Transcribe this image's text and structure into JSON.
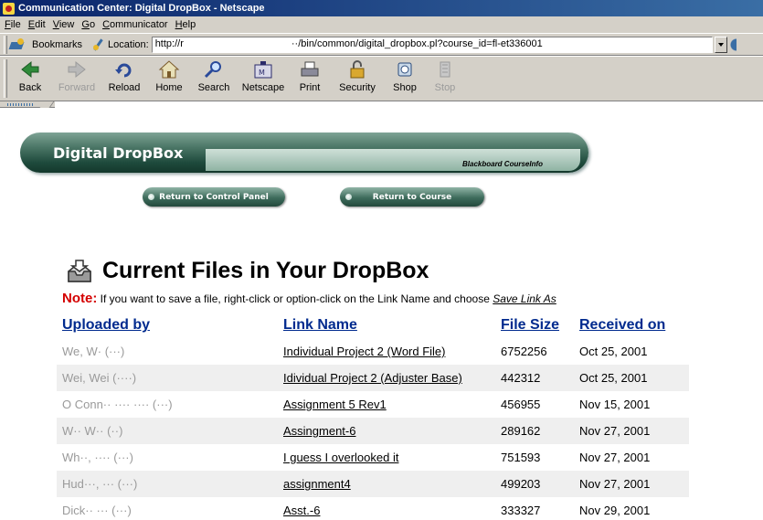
{
  "window": {
    "title": "Communication Center: Digital DropBox - Netscape"
  },
  "menu": [
    "File",
    "Edit",
    "View",
    "Go",
    "Communicator",
    "Help"
  ],
  "location_bar": {
    "bookmarks_label": "Bookmarks",
    "location_label": "Location:",
    "url_start": "http://r",
    "url_end": "··/bin/common/digital_dropbox.pl?course_id=fl-et336001"
  },
  "toolbar": [
    {
      "label": "Back",
      "icon": "back-arrow-icon",
      "enabled": true
    },
    {
      "label": "Forward",
      "icon": "forward-arrow-icon",
      "enabled": false
    },
    {
      "label": "Reload",
      "icon": "reload-icon",
      "enabled": true
    },
    {
      "label": "Home",
      "icon": "home-icon",
      "enabled": true
    },
    {
      "label": "Search",
      "icon": "search-icon",
      "enabled": true
    },
    {
      "label": "Netscape",
      "icon": "netscape-icon",
      "enabled": true
    },
    {
      "label": "Print",
      "icon": "print-icon",
      "enabled": true
    },
    {
      "label": "Security",
      "icon": "security-lock-icon",
      "enabled": true
    },
    {
      "label": "Shop",
      "icon": "shop-icon",
      "enabled": true
    },
    {
      "label": "Stop",
      "icon": "stop-icon",
      "enabled": false
    }
  ],
  "banner": {
    "title": "Digital DropBox",
    "subtitle": "Blackboard CourseInfo"
  },
  "buttons": {
    "control_panel": "Return to Control Panel",
    "course": "Return to Course"
  },
  "page": {
    "heading": "Current Files in Your DropBox",
    "note_label": "Note:",
    "note_text": " If you want to save a file, right-click or option-click on the Link Name and choose ",
    "note_action": "Save Link As"
  },
  "table": {
    "headers": [
      "Uploaded by",
      "Link Name",
      "File Size",
      "Received on"
    ],
    "rows": [
      {
        "uploader": "We, W· (···)",
        "link": "Individual Project 2 (Word File)",
        "size": "6752256",
        "date": "Oct 25, 2001"
      },
      {
        "uploader": "Wei, Wei (····)",
        "link": "Idividual Project 2 (Adjuster Base)",
        "size": "442312",
        "date": "Oct 25, 2001"
      },
      {
        "uploader": "O Conn·· ···· ···· (···)",
        "link": "Assignment 5 Rev1",
        "size": "456955",
        "date": "Nov 15, 2001"
      },
      {
        "uploader": "W·· W·· (··)",
        "link": "Assingment-6",
        "size": "289162",
        "date": "Nov 27, 2001"
      },
      {
        "uploader": "Wh··, ···· (···)",
        "link": "I guess I overlooked it",
        "size": "751593",
        "date": "Nov 27, 2001"
      },
      {
        "uploader": "Hud···, ··· (···)",
        "link": "assignment4",
        "size": "499203",
        "date": "Nov 27, 2001"
      },
      {
        "uploader": "Dick·· ··· (···)",
        "link": "Asst.-6",
        "size": "333327",
        "date": "Nov 29, 2001"
      }
    ]
  },
  "colors": {
    "title_bar": "#0a246a",
    "banner_green": "#1e4a3c",
    "header_blue": "#002a8e",
    "note_red": "#d40000",
    "alt_row": "#efefef"
  }
}
